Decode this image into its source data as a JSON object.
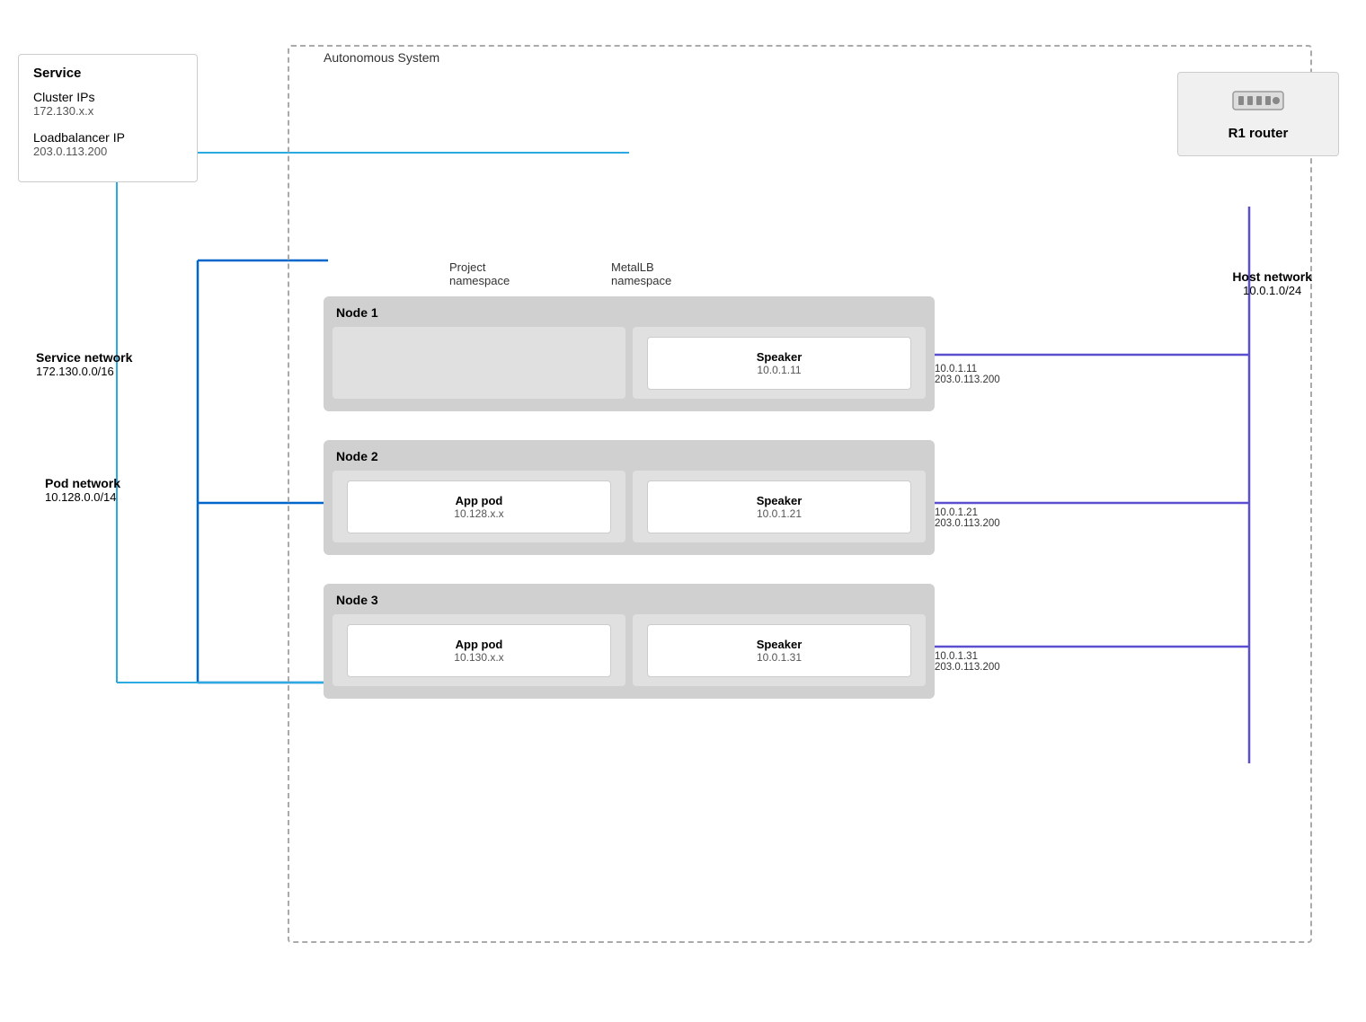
{
  "service_box": {
    "title": "Service",
    "items": [
      {
        "label": "Cluster IPs",
        "value": "172.130.x.x"
      },
      {
        "label": "Loadbalancer IP",
        "value": "203.0.113.200"
      }
    ]
  },
  "autonomous_system": {
    "label": "Autonomous System"
  },
  "router": {
    "label": "R1 router"
  },
  "host_network": {
    "title": "Host network",
    "cidr": "10.0.1.0/24"
  },
  "namespaces": {
    "project": "Project\nnamespace",
    "metallb": "MetalLB\nnamespace"
  },
  "nodes": [
    {
      "label": "Node 1",
      "pods": [
        {
          "name": "",
          "ip": ""
        },
        {
          "name": "Speaker",
          "ip": "10.0.1.11"
        }
      ]
    },
    {
      "label": "Node 2",
      "pods": [
        {
          "name": "App pod",
          "ip": "10.128.x.x"
        },
        {
          "name": "Speaker",
          "ip": "10.0.1.21"
        }
      ]
    },
    {
      "label": "Node 3",
      "pods": [
        {
          "name": "App pod",
          "ip": "10.130.x.x"
        },
        {
          "name": "Speaker",
          "ip": "10.0.1.31"
        }
      ]
    }
  ],
  "bgp_labels": [
    {
      "id": "bgp1",
      "lines": [
        "10.0.1.11",
        "203.0.113.200"
      ]
    },
    {
      "id": "bgp2",
      "lines": [
        "10.0.1.21",
        "203.0.113.200"
      ]
    },
    {
      "id": "bgp3",
      "lines": [
        "10.0.1.31",
        "203.0.113.200"
      ]
    }
  ],
  "service_network": {
    "title": "Service network",
    "cidr": "172.130.0.0/16"
  },
  "pod_network": {
    "title": "Pod network",
    "cidr": "10.128.0.0/14"
  }
}
